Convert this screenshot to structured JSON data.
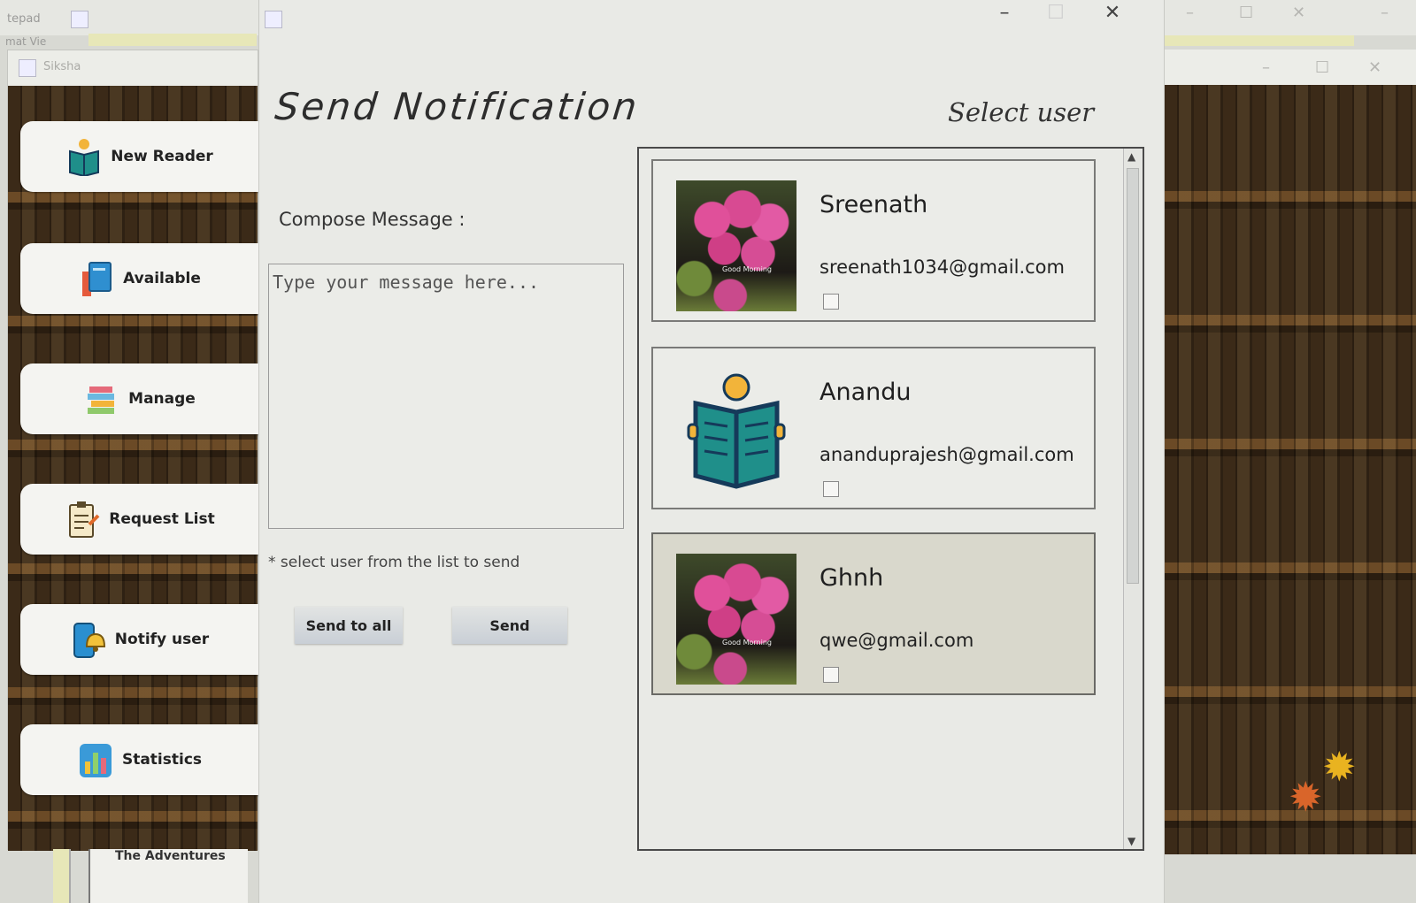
{
  "background": {
    "notepad_title": "tepad",
    "notepad_menu": "mat  Vie",
    "sidebar_window_title": "Siksha",
    "below_text": "The Adventures"
  },
  "sidebar": {
    "items": [
      {
        "label": "New Reader",
        "icon": "reader-book-icon"
      },
      {
        "label": "Available",
        "icon": "books-icon"
      },
      {
        "label": "Manage",
        "icon": "stacked-books-icon"
      },
      {
        "label": "Request List",
        "icon": "clipboard-icon"
      },
      {
        "label": "Notify user",
        "icon": "phone-bell-icon"
      },
      {
        "label": "Statistics",
        "icon": "bar-chart-icon"
      }
    ]
  },
  "dialog": {
    "title": "Send Notification",
    "select_user_label": "Select user",
    "compose_label": "Compose Message :",
    "message_placeholder": "Type your message here...",
    "hint": "*  select user from the list to send",
    "send_all_label": "Send to all",
    "send_label": "Send",
    "window_controls": {
      "minimize": "–",
      "maximize": "☐",
      "close": "✕"
    }
  },
  "users": [
    {
      "name": "Sreenath",
      "email": "sreenath1034@gmail.com",
      "avatar": "flowers",
      "checked": false,
      "selected": false
    },
    {
      "name": "Anandu",
      "email": "ananduprajesh@gmail.com",
      "avatar": "reader-icon",
      "checked": false,
      "selected": false
    },
    {
      "name": "Ghnh",
      "email": "qwe@gmail.com",
      "avatar": "flowers",
      "checked": false,
      "selected": true
    }
  ],
  "colors": {
    "accent_button": "#c9cfd6",
    "selected_card": "#d9d8cc",
    "reader_teal": "#1f8f8a"
  }
}
